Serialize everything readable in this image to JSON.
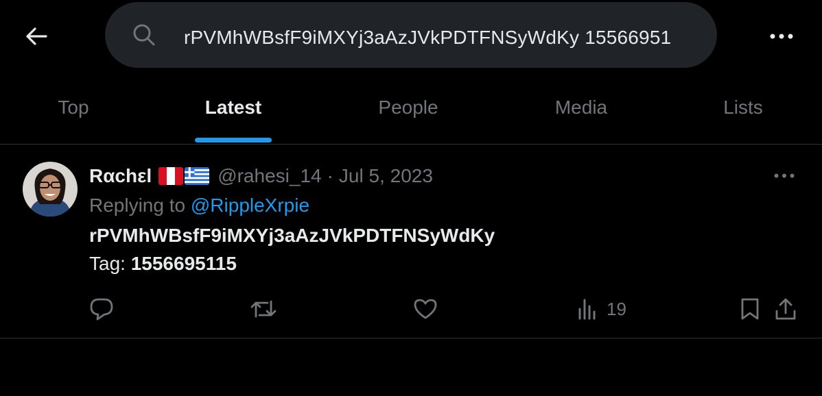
{
  "search": {
    "query": "rPVMhWBsfF9iMXYj3aAzJVkPDTFNSyWdKy 15566951"
  },
  "tabs": [
    {
      "label": "Top",
      "active": false
    },
    {
      "label": "Latest",
      "active": true
    },
    {
      "label": "People",
      "active": false
    },
    {
      "label": "Media",
      "active": false
    },
    {
      "label": "Lists",
      "active": false
    }
  ],
  "post": {
    "display_name": "Rαchεl",
    "handle": "@rahesi_14",
    "separator": "·",
    "date": "Jul 5, 2023",
    "replying_prefix": "Replying to",
    "replying_to": "@RippleXrpie",
    "line1": "rPVMhWBsfF9iMXYj3aAzJVkPDTFNSyWdKy",
    "tag_label": "Tag:",
    "tag_value": "1556695115",
    "views": "19",
    "flags": [
      "flag-peru-icon",
      "flag-greece-icon"
    ]
  },
  "colors": {
    "background": "#000000",
    "accent": "#1d9bf0",
    "muted": "#71767b",
    "search_bg": "#202327",
    "divider": "#2f3336"
  },
  "icons": [
    "back-arrow-icon",
    "search-icon",
    "more-icon",
    "reply-icon",
    "repost-icon",
    "like-icon",
    "views-icon",
    "bookmark-icon",
    "share-icon"
  ]
}
